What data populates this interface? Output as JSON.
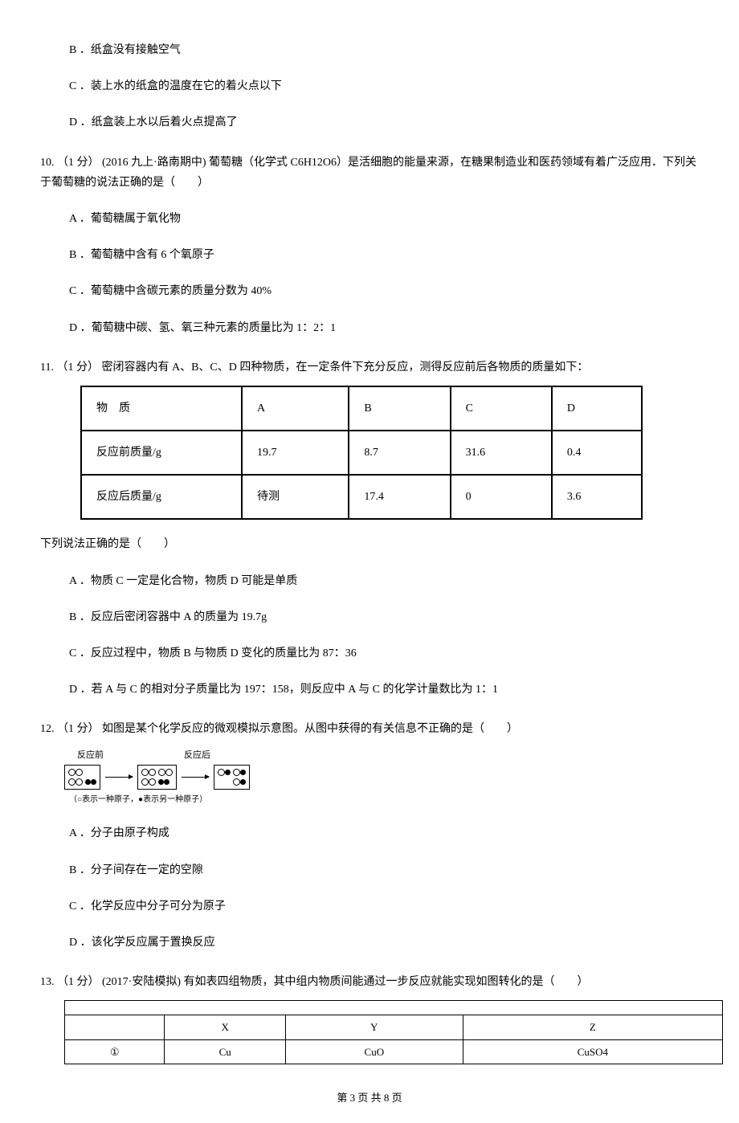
{
  "q9_options": {
    "b": "B ．纸盒没有接触空气",
    "c": "C ．装上水的纸盒的温度在它的着火点以下",
    "d": "D ．纸盒装上水以后着火点提高了"
  },
  "q10": {
    "stem": "10. （1 分） (2016 九上·路南期中) 葡萄糖（化学式 C6H12O6）是活细胞的能量来源，在糖果制造业和医药领域有着广泛应用．下列关于葡萄糖的说法正确的是（　　）",
    "a": "A ．葡萄糖属于氧化物",
    "b": "B ．葡萄糖中含有 6 个氧原子",
    "c": "C ．葡萄糖中含碳元素的质量分数为 40%",
    "d": "D ．葡萄糖中碳、氢、氧三种元素的质量比为 1：2：1"
  },
  "q11": {
    "stem": "11. （1 分） 密闭容器内有 A、B、C、D 四种物质，在一定条件下充分反应，测得反应前后各物质的质量如下：",
    "after": "下列说法正确的是（　　）",
    "a": "A ．物质 C 一定是化合物，物质 D 可能是单质",
    "b": "B ．反应后密闭容器中 A 的质量为 19.7g",
    "c": "C ．反应过程中，物质 B 与物质 D 变化的质量比为 87：36",
    "d": "D ．若 A 与 C 的相对分子质量比为 197：158，则反应中 A 与 C 的化学计量数比为 1：1"
  },
  "table11": {
    "r1c1": "物　质",
    "r1c2": "A",
    "r1c3": "B",
    "r1c4": "C",
    "r1c5": "D",
    "r2c1": "反应前质量/g",
    "r2c2": "19.7",
    "r2c3": "8.7",
    "r2c4": "31.6",
    "r2c5": "0.4",
    "r3c1": "反应后质量/g",
    "r3c2": "待测",
    "r3c3": "17.4",
    "r3c4": "0",
    "r3c5": "3.6"
  },
  "q12": {
    "stem": "12. （1 分） 如图是某个化学反应的微观模拟示意图。从图中获得的有关信息不正确的是（　　）",
    "label_before": "反应前",
    "label_after": "反应后",
    "legend": "（○表示一种原子，●表示另一种原子）",
    "a": "A ．分子由原子构成",
    "b": "B ．分子间存在一定的空隙",
    "c": "C ．化学反应中分子可分为原子",
    "d": "D ．该化学反应属于置换反应"
  },
  "q13": {
    "stem": "13. （1 分） (2017·安陆模拟) 有如表四组物质，其中组内物质间能通过一步反应就能实现如图转化的是（　　）"
  },
  "table13": {
    "h1": "",
    "h2": "X",
    "h3": "Y",
    "h4": "Z",
    "r1c1": "①",
    "r1c2": "Cu",
    "r1c3": "CuO",
    "r1c4": "CuSO4"
  },
  "footer": "第 3 页 共 8 页"
}
